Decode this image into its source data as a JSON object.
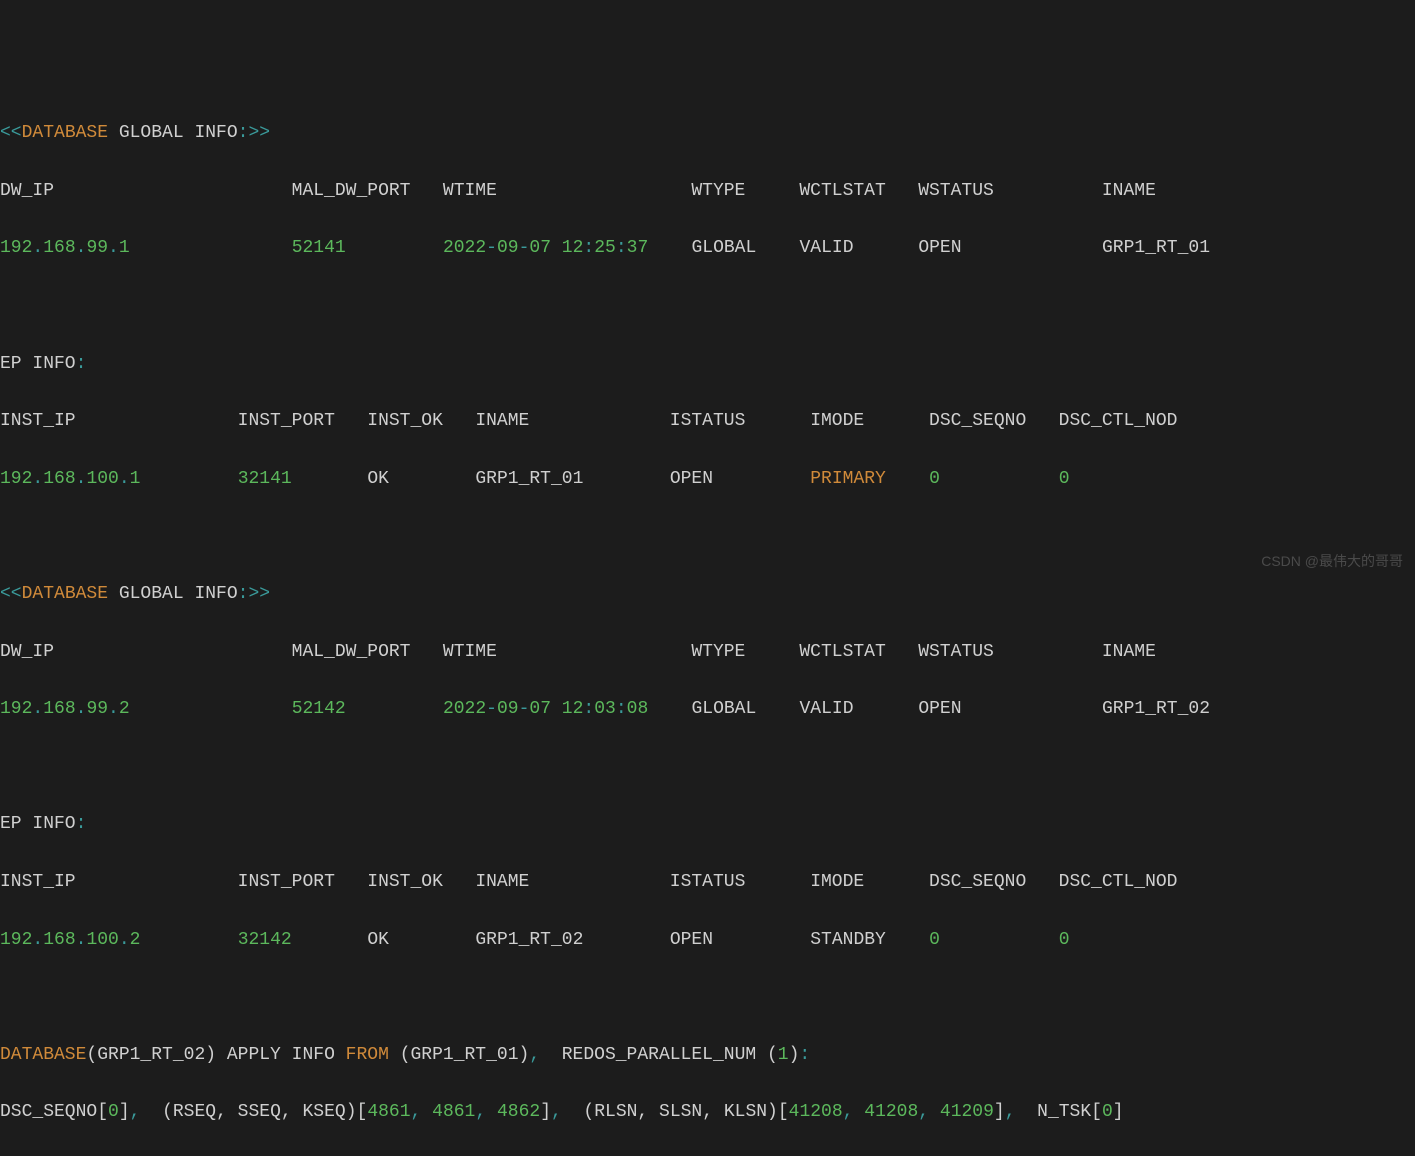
{
  "header_label": "DATABASE",
  "header_rest": " GLOBAL INFO",
  "ep_info_label": "EP INFO",
  "db1": {
    "cols": {
      "dw_ip": "DW_IP",
      "mal_dw_port": "MAL_DW_PORT",
      "wtime": "WTIME",
      "wtype": "WTYPE",
      "wctlstat": "WCTLSTAT",
      "wstatus": "WSTATUS",
      "iname": "INAME"
    },
    "vals": {
      "dw_ip": "192.168.99.1",
      "mal_dw_port": "52141",
      "wtime": "2022-09-07 12:25:37",
      "wtype": "GLOBAL",
      "wctlstat": "VALID",
      "wstatus": "OPEN",
      "iname": "GRP1_RT_01"
    }
  },
  "ep1": {
    "cols": {
      "inst_ip": "INST_IP",
      "inst_port": "INST_PORT",
      "inst_ok": "INST_OK",
      "iname": "INAME",
      "istatus": "ISTATUS",
      "imode": "IMODE",
      "dsc_seqno": "DSC_SEQNO",
      "dsc_ctl_nod": "DSC_CTL_NOD"
    },
    "vals": {
      "inst_ip": "192.168.100.1",
      "inst_port": "32141",
      "inst_ok": "OK",
      "iname": "GRP1_RT_01",
      "istatus": "OPEN",
      "imode": "PRIMARY",
      "dsc_seqno": "0",
      "dsc_ctl_nod": "0"
    }
  },
  "db2": {
    "cols": {
      "dw_ip": "DW_IP",
      "mal_dw_port": "MAL_DW_PORT",
      "wtime": "WTIME",
      "wtype": "WTYPE",
      "wctlstat": "WCTLSTAT",
      "wstatus": "WSTATUS",
      "iname": "INAME"
    },
    "vals": {
      "dw_ip": "192.168.99.2",
      "mal_dw_port": "52142",
      "wtime": "2022-09-07 12:03:08",
      "wtype": "GLOBAL",
      "wctlstat": "VALID",
      "wstatus": "OPEN",
      "iname": "GRP1_RT_02"
    }
  },
  "ep2": {
    "cols": {
      "inst_ip": "INST_IP",
      "inst_port": "INST_PORT",
      "inst_ok": "INST_OK",
      "iname": "INAME",
      "istatus": "ISTATUS",
      "imode": "IMODE",
      "dsc_seqno": "DSC_SEQNO",
      "dsc_ctl_nod": "DSC_CTL_NOD"
    },
    "vals": {
      "inst_ip": "192.168.100.2",
      "inst_port": "32142",
      "inst_ok": "OK",
      "iname": "GRP1_RT_02",
      "istatus": "OPEN",
      "imode": "STANDBY",
      "dsc_seqno": "0",
      "dsc_ctl_nod": "0"
    }
  },
  "apply": {
    "kw_database": "DATABASE",
    "group_to": "(GRP1_RT_02)",
    "mid": " APPLY INFO ",
    "kw_from": "FROM",
    "group_from_open": " (GRP1_RT_01)",
    "redos_open": " REDOS_PARALLEL_NUM (",
    "redos_num": "1",
    "redos_close": ")",
    "dsc_seq_open": "DSC_SEQNO[",
    "dsc_seq_val": "0",
    "dsc_seq_close": "]",
    "rseq_open": " (RSEQ, SSEQ, KSEQ)[",
    "rseq_v1": "4861",
    "rseq_v2": "4861",
    "rseq_v3": "4862",
    "rseq_close": "]",
    "rlsn_open": " (RLSN, SLSN, KLSN)[",
    "rlsn_v1": "41208",
    "rlsn_v2": "41208",
    "rlsn_v3": "41209",
    "rlsn_close": "]",
    "ntsk_open": " N_TSK[",
    "ntsk_val": "0",
    "ntsk_close": "]"
  },
  "punct": {
    "ltlt": "<<",
    "gtgt": ">>",
    "comma": ", ",
    "colon": ":",
    "colonp": ":",
    "dot": ".",
    "dash": "-",
    "space": " "
  },
  "watermark": "CSDN @最伟大的哥哥"
}
